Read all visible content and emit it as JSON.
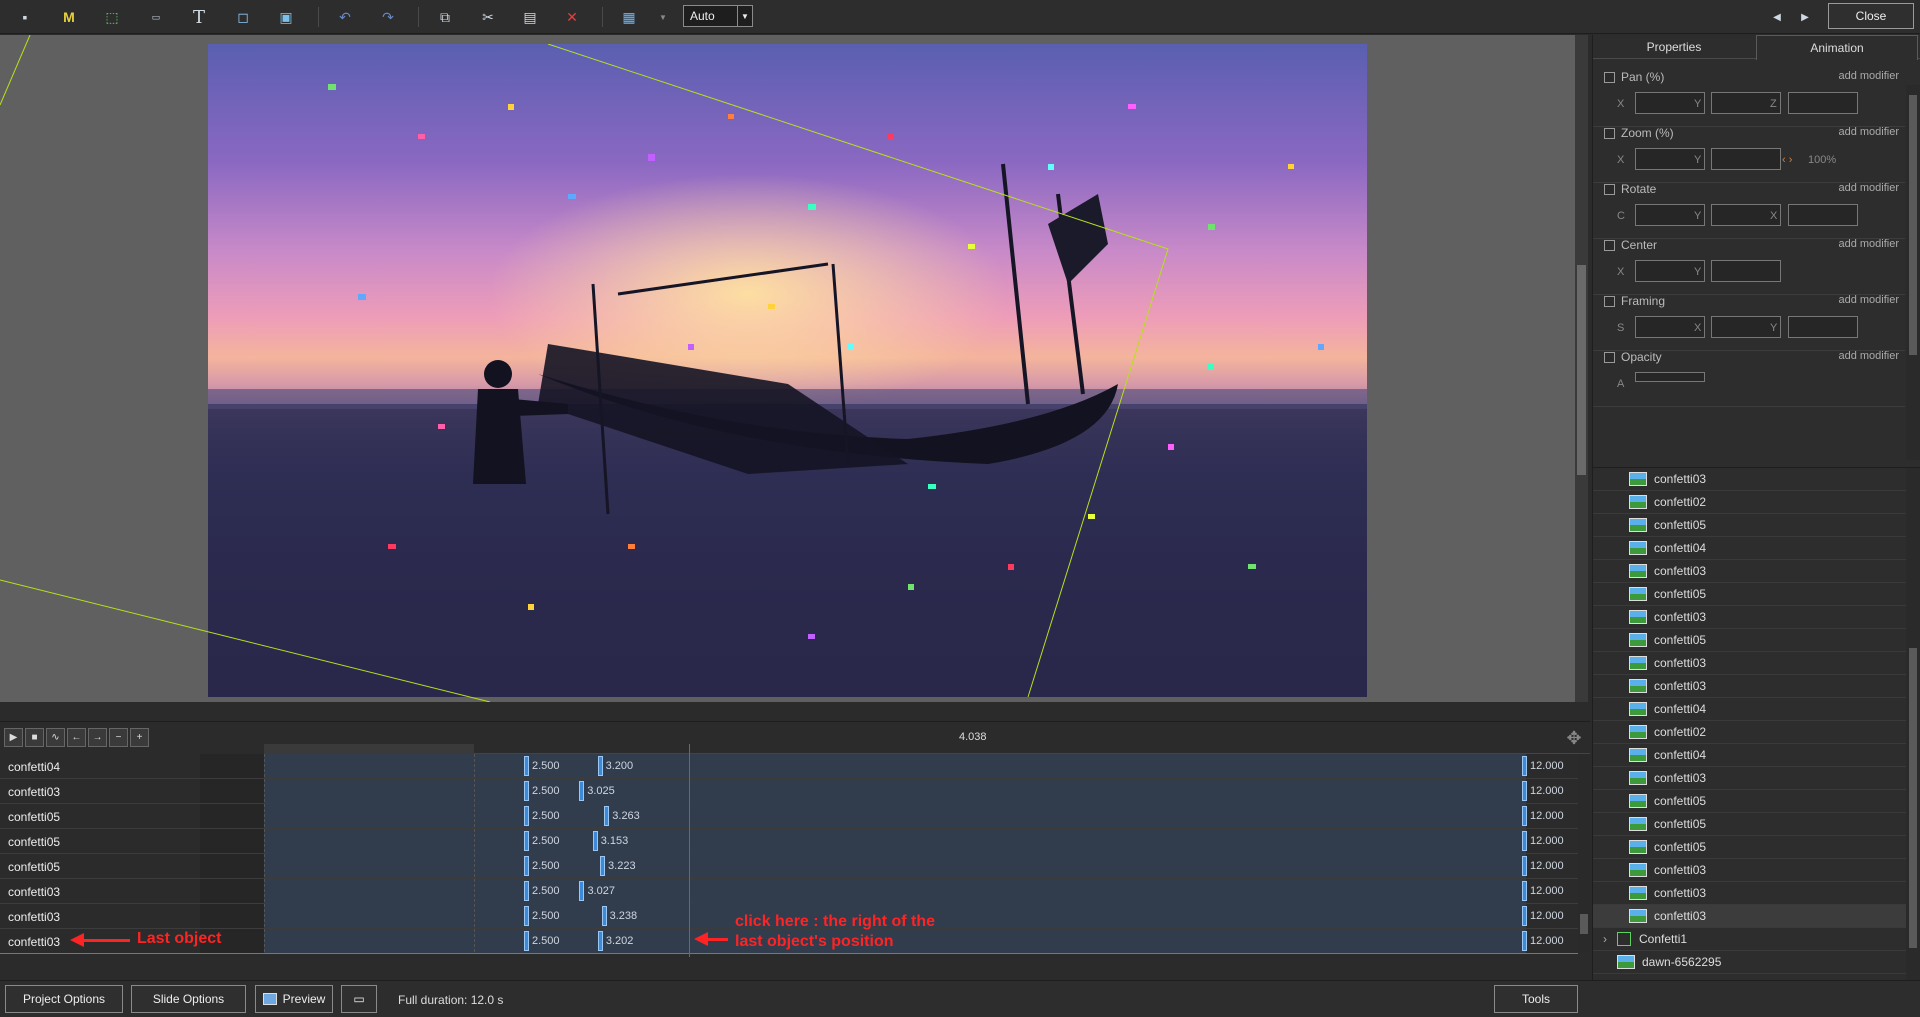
{
  "toolbar": {
    "auto_label": "Auto",
    "close_label": "Close",
    "icons": [
      "camera-icon",
      "mask-icon",
      "rectangle-icon",
      "video-icon",
      "text-icon",
      "frame-icon",
      "image-icon",
      "undo-icon",
      "redo-icon",
      "copy-icon",
      "cut-icon",
      "paste-icon",
      "delete-icon",
      "grid-icon"
    ]
  },
  "panel": {
    "tabs": [
      "Properties",
      "Animation"
    ],
    "active_tab": "Animation",
    "add_modifier": "add modifier",
    "groups": [
      {
        "label": "Pan (%)",
        "fields": [
          "X",
          "Y",
          "Z"
        ]
      },
      {
        "label": "Zoom (%)",
        "fields": [
          "X",
          "Y"
        ],
        "extra": "100%"
      },
      {
        "label": "Rotate",
        "fields": [
          "C",
          "Y",
          "X"
        ]
      },
      {
        "label": "Center",
        "fields": [
          "X",
          "Y"
        ]
      },
      {
        "label": "Framing",
        "fields": [
          "S",
          "X",
          "Y"
        ]
      },
      {
        "label": "Opacity",
        "fields": [
          "A"
        ]
      }
    ]
  },
  "tree": {
    "items": [
      "confetti03",
      "confetti02",
      "confetti05",
      "confetti04",
      "confetti03",
      "confetti05",
      "confetti03",
      "confetti05",
      "confetti03",
      "confetti03",
      "confetti04",
      "confetti02",
      "confetti04",
      "confetti03",
      "confetti05",
      "confetti05",
      "confetti05",
      "confetti03",
      "confetti03",
      "confetti03"
    ],
    "selected_index": 19,
    "group_label": "Confetti1",
    "background_label": "dawn-6562295"
  },
  "timeline": {
    "current_time": "4.038",
    "rows": [
      {
        "name": "confetti04",
        "start": "2.500",
        "kf2": "3.200",
        "end": "12.000"
      },
      {
        "name": "confetti03",
        "start": "2.500",
        "kf2": "3.025",
        "end": "12.000"
      },
      {
        "name": "confetti05",
        "start": "2.500",
        "kf2": "3.263",
        "end": "12.000"
      },
      {
        "name": "confetti05",
        "start": "2.500",
        "kf2": "3.153",
        "end": "12.000"
      },
      {
        "name": "confetti05",
        "start": "2.500",
        "kf2": "3.223",
        "end": "12.000"
      },
      {
        "name": "confetti03",
        "start": "2.500",
        "kf2": "3.027",
        "end": "12.000"
      },
      {
        "name": "confetti03",
        "start": "2.500",
        "kf2": "3.238",
        "end": "12.000"
      },
      {
        "name": "confetti03",
        "start": "2.500",
        "kf2": "3.202",
        "end": "12.000"
      }
    ],
    "annotations": {
      "last_object": "Last object",
      "click_here_1": "click here : the right of the",
      "click_here_2": "last object's position"
    }
  },
  "bottom": {
    "project_options": "Project Options",
    "slide_options": "Slide Options",
    "preview": "Preview",
    "full_duration": "Full duration: 12.0 s",
    "tools": "Tools"
  }
}
